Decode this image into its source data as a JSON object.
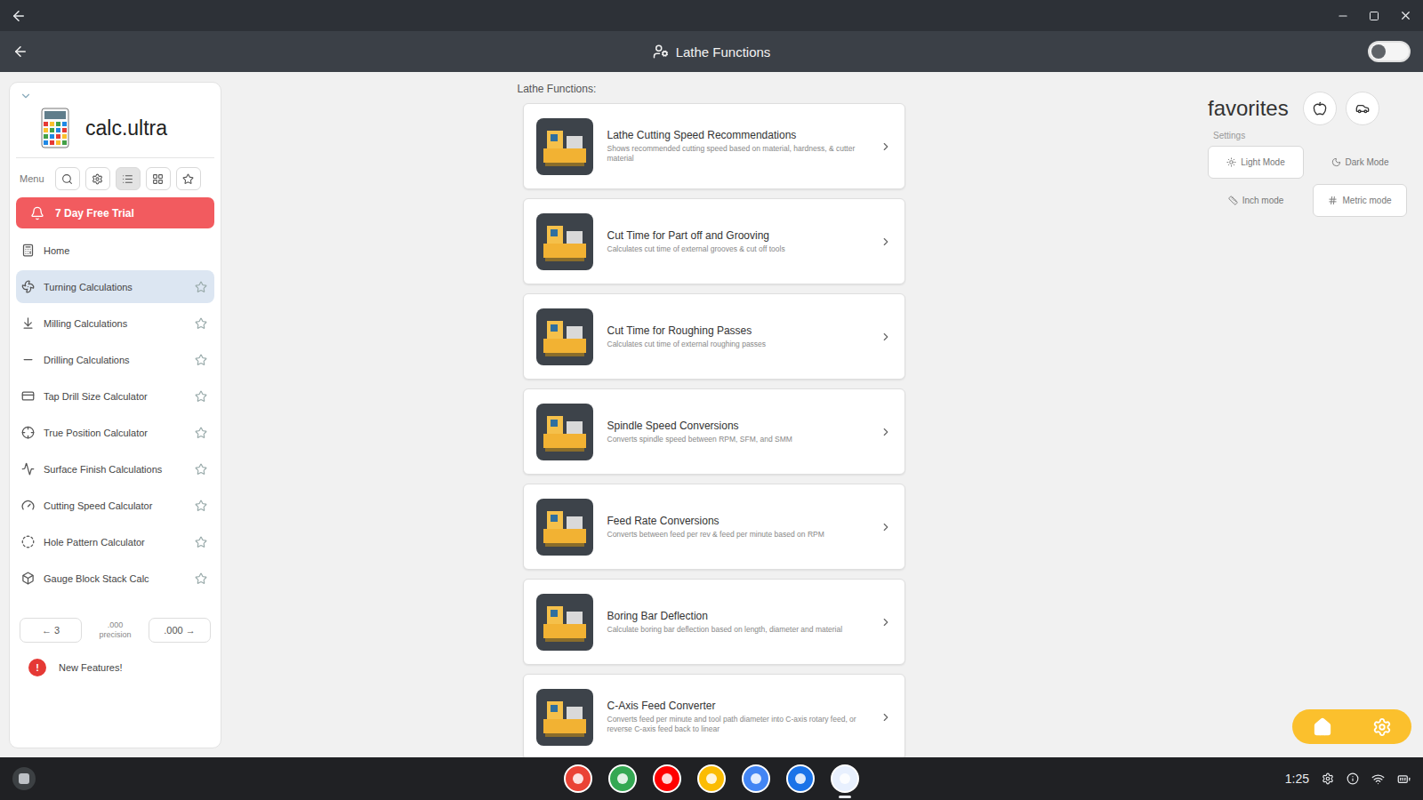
{
  "window": {
    "title": "Lathe Functions"
  },
  "header": {
    "toggle": {
      "on": false
    }
  },
  "sidebar": {
    "app_name": "calc.ultra",
    "menu_label": "Menu",
    "menu_tools": [
      {
        "kind": "search",
        "selected": false
      },
      {
        "kind": "settings",
        "selected": false
      },
      {
        "kind": "list",
        "selected": true
      },
      {
        "kind": "grid",
        "selected": false
      },
      {
        "kind": "star",
        "selected": false
      }
    ],
    "trial_button": "7 Day Free Trial",
    "items": [
      {
        "label": "Home",
        "kind": "home",
        "selected": false,
        "starrable": false,
        "starred": false
      },
      {
        "label": "Turning Calculations",
        "kind": "turning",
        "selected": true,
        "starrable": true,
        "starred": false
      },
      {
        "label": "Milling Calculations",
        "kind": "milling",
        "selected": false,
        "starrable": true,
        "starred": false
      },
      {
        "label": "Drilling Calculations",
        "kind": "drilling",
        "selected": false,
        "starrable": true,
        "starred": false
      },
      {
        "label": "Tap Drill Size Calculator",
        "kind": "tap",
        "selected": false,
        "starrable": true,
        "starred": false
      },
      {
        "label": "True Position Calculator",
        "kind": "position",
        "selected": false,
        "starrable": true,
        "starred": false
      },
      {
        "label": "Surface Finish Calculations",
        "kind": "surface",
        "selected": false,
        "starrable": true,
        "starred": false
      },
      {
        "label": "Cutting Speed Calculator",
        "kind": "speed",
        "selected": false,
        "starrable": true,
        "starred": false
      },
      {
        "label": "Hole Pattern Calculator",
        "kind": "hole",
        "selected": false,
        "starrable": true,
        "starred": false
      },
      {
        "label": "Gauge Block Stack Calc",
        "kind": "gauge",
        "selected": false,
        "starrable": true,
        "starred": false
      }
    ],
    "precision": {
      "decrease": "← 3",
      "value": ".000",
      "label": "precision",
      "increase": ".000 →"
    },
    "new_features": {
      "label": "New Features!",
      "badge": "!"
    }
  },
  "section_title": "Lathe Functions:",
  "functions": [
    {
      "title": "Lathe Cutting Speed Recommendations",
      "description": "Shows recommended cutting speed based on material, hardness, & cutter material"
    },
    {
      "title": "Cut Time for Part off and Grooving",
      "description": "Calculates cut time of external grooves & cut off tools"
    },
    {
      "title": "Cut Time for Roughing Passes",
      "description": "Calculates cut time of external roughing passes"
    },
    {
      "title": "Spindle Speed Conversions",
      "description": "Converts spindle speed between RPM, SFM, and SMM"
    },
    {
      "title": "Feed Rate Conversions",
      "description": "Converts between feed per rev & feed per minute based on RPM"
    },
    {
      "title": "Boring Bar Deflection",
      "description": "Calculate boring bar deflection based on length, diameter and material"
    },
    {
      "title": "C-Axis Feed Converter",
      "description": "Converts feed per minute and tool path diameter into C-axis rotary feed, or reverse C-axis feed back to linear"
    }
  ],
  "favorites": {
    "title": "favorites",
    "buttons": [
      {
        "kind": "apple"
      },
      {
        "kind": "car"
      }
    ]
  },
  "settings": {
    "label": "Settings",
    "options": [
      {
        "label": "Light Mode",
        "kind": "sun",
        "selected": true
      },
      {
        "label": "Dark Mode",
        "kind": "moon",
        "selected": false
      },
      {
        "label": "Inch mode",
        "kind": "inch",
        "selected": false
      },
      {
        "label": "Metric mode",
        "kind": "metric",
        "selected": true
      }
    ]
  },
  "taskbar": {
    "time": "1:25",
    "apps": [
      {
        "color": "#ea4335",
        "selected": false
      },
      {
        "color": "#34a853",
        "selected": false
      },
      {
        "color": "#ff0000",
        "selected": false
      },
      {
        "color": "#fbbc04",
        "selected": false
      },
      {
        "color": "#4285f4",
        "selected": false
      },
      {
        "color": "#1a73e8",
        "selected": false
      },
      {
        "color": "#e8f0fe",
        "selected": true
      }
    ]
  }
}
